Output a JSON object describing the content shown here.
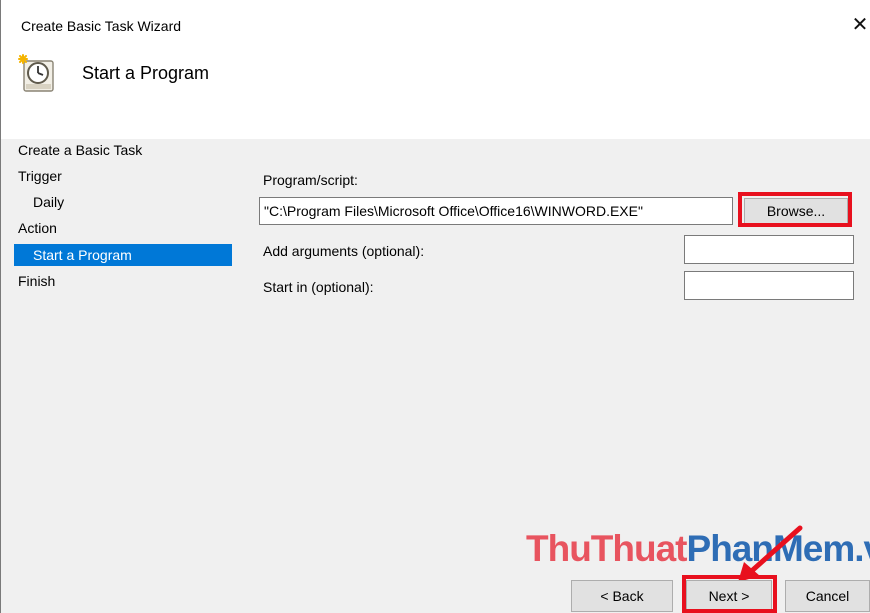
{
  "window": {
    "title": "Create Basic Task Wizard",
    "close_glyph": "✕",
    "icon": "task-scheduler-clock-icon"
  },
  "header": {
    "title": "Start a Program"
  },
  "nav": {
    "items": [
      {
        "label": "Create a Basic Task",
        "selected": false
      },
      {
        "label": "Trigger",
        "selected": false
      },
      {
        "label": "Daily",
        "selected": false
      },
      {
        "label": "Action",
        "selected": false
      },
      {
        "label": "Start a Program",
        "selected": true
      },
      {
        "label": "Finish",
        "selected": false
      }
    ]
  },
  "form": {
    "program_label": "Program/script:",
    "program_value": "\"C:\\Program Files\\Microsoft Office\\Office16\\WINWORD.EXE\"",
    "browse_label": "Browse...",
    "arguments_label": "Add arguments (optional):",
    "arguments_value": "",
    "start_in_label": "Start in (optional):",
    "start_in_value": ""
  },
  "buttons": {
    "back": "< Back",
    "next": "Next >",
    "cancel": "Cancel"
  },
  "watermark": {
    "part1": "ThuThuat",
    "part2": "PhanMem",
    "part3": ".vn"
  },
  "colors": {
    "selection": "#0078d7",
    "highlight": "#e8101e",
    "watermark_red": "#e8545f",
    "watermark_blue": "#2e6db5"
  }
}
